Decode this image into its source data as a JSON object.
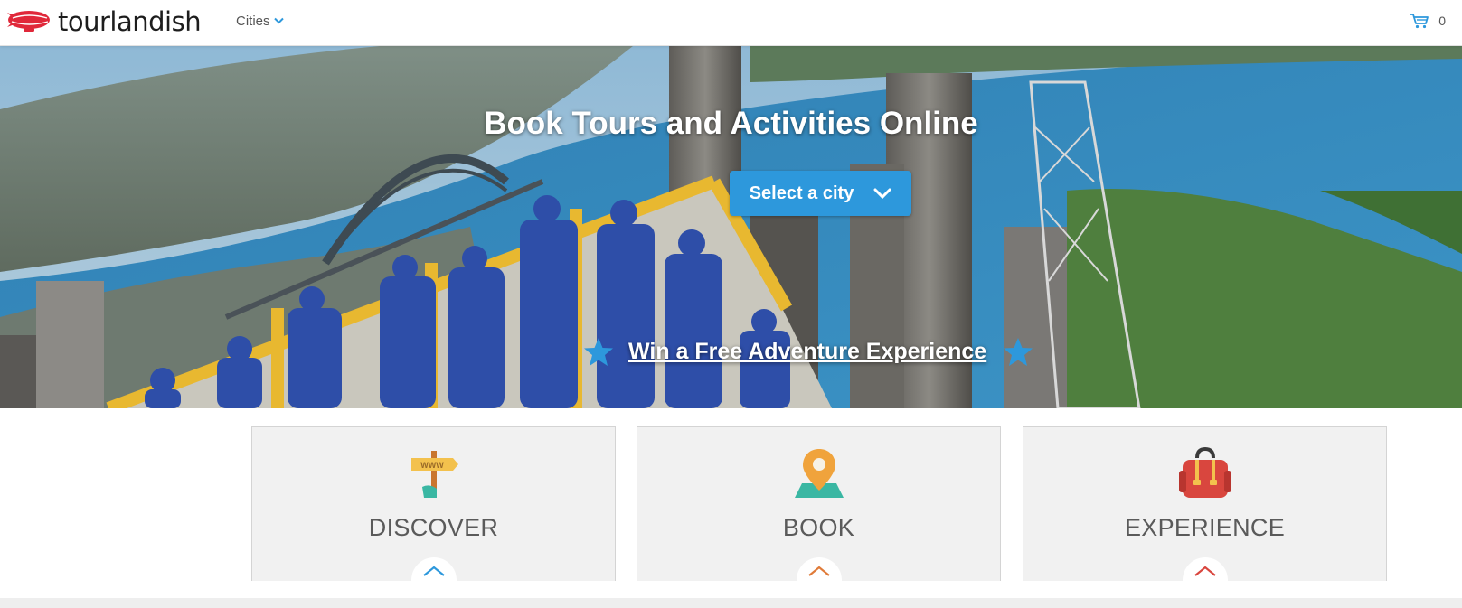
{
  "header": {
    "logo_text": "tourlandish",
    "nav_cities_label": "Cities",
    "cart_count": "0"
  },
  "hero": {
    "title": "Book Tours and Activities Online",
    "select_city_label": "Select a city",
    "promo_text": "Win a Free Adventure Experience"
  },
  "features": [
    {
      "title": "DISCOVER",
      "icon": "signpost-icon",
      "sign_text": "WWW",
      "toggle_color": "#2d98dc"
    },
    {
      "title": "BOOK",
      "icon": "map-pin-icon",
      "toggle_color": "#e07b39"
    },
    {
      "title": "EXPERIENCE",
      "icon": "backpack-icon",
      "toggle_color": "#d9463e"
    }
  ],
  "colors": {
    "accent": "#2d98dc",
    "brand_red": "#e0283a",
    "title_gray": "#5a5a5a",
    "card_bg": "#f1f1f1"
  }
}
